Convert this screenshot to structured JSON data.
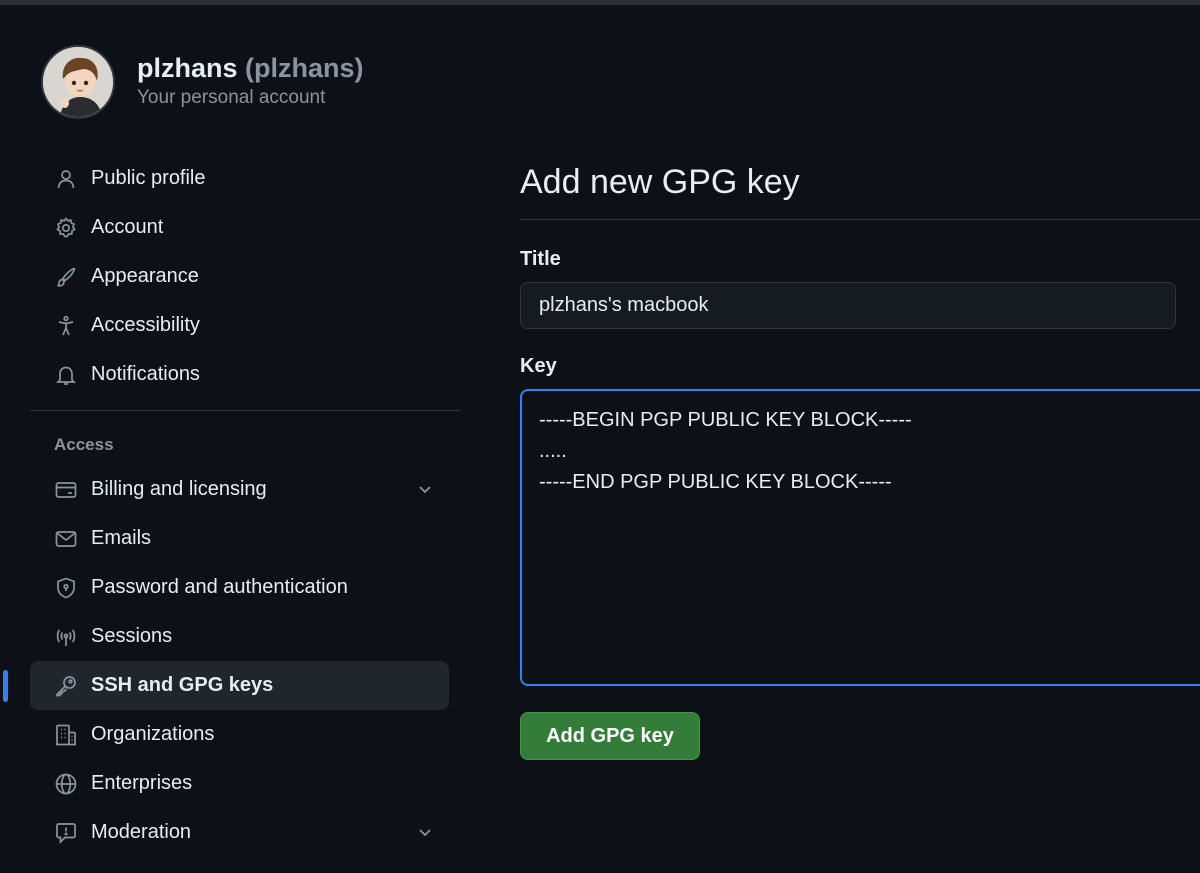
{
  "profile": {
    "name": "plzhans",
    "handle": "(plzhans)",
    "subtitle": "Your personal account"
  },
  "sidebar": {
    "items": [
      {
        "label": "Public profile",
        "icon": "person-icon"
      },
      {
        "label": "Account",
        "icon": "gear-icon"
      },
      {
        "label": "Appearance",
        "icon": "paintbrush-icon"
      },
      {
        "label": "Accessibility",
        "icon": "accessibility-icon"
      },
      {
        "label": "Notifications",
        "icon": "bell-icon"
      }
    ],
    "access_heading": "Access",
    "access_items": [
      {
        "label": "Billing and licensing",
        "icon": "credit-card-icon",
        "expandable": true
      },
      {
        "label": "Emails",
        "icon": "mail-icon"
      },
      {
        "label": "Password and authentication",
        "icon": "shield-lock-icon"
      },
      {
        "label": "Sessions",
        "icon": "broadcast-icon"
      },
      {
        "label": "SSH and GPG keys",
        "icon": "key-icon",
        "active": true
      },
      {
        "label": "Organizations",
        "icon": "organization-icon"
      },
      {
        "label": "Enterprises",
        "icon": "globe-icon"
      },
      {
        "label": "Moderation",
        "icon": "report-icon",
        "expandable": true
      }
    ]
  },
  "main": {
    "title": "Add new GPG key",
    "title_label": "Title",
    "title_value": "plzhans's macbook",
    "key_label": "Key",
    "key_value": "-----BEGIN PGP PUBLIC KEY BLOCK-----\n.....\n-----END PGP PUBLIC KEY BLOCK-----",
    "submit_label": "Add GPG key"
  },
  "colors": {
    "background": "#0d1117",
    "accent_blue": "#2f81f7",
    "button_green": "#347d39",
    "muted_text": "#8b949e"
  }
}
